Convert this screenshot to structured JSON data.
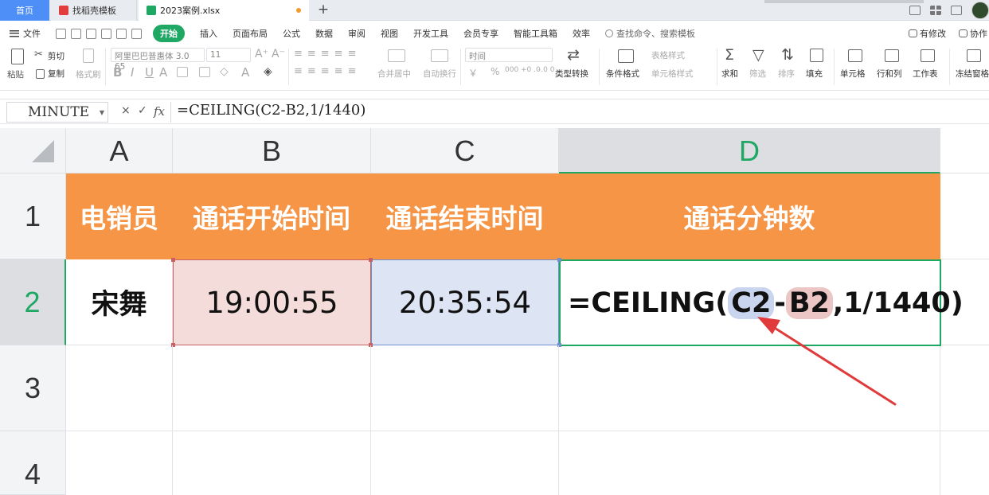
{
  "tabs": {
    "home": "首页",
    "template": "找稻壳模板",
    "file": "2023案例.xlsx",
    "add": "+"
  },
  "menubar": {
    "file": "文件",
    "items": [
      "开始",
      "插入",
      "页面布局",
      "公式",
      "数据",
      "审阅",
      "视图",
      "开发工具",
      "会员专享",
      "智能工具箱",
      "效率"
    ],
    "active_index": 0,
    "search": "查找命令、搜索模板",
    "right": {
      "changes": "有修改",
      "collab": "协作"
    }
  },
  "ribbon": {
    "paste": "粘贴",
    "cut": "剪切",
    "copy": "复制",
    "format_painter": "格式刷",
    "font_name": "阿里巴巴普惠体 3.0 65",
    "font_size": "11",
    "merge": "合并居中",
    "wrap": "自动换行",
    "number_format": "时间",
    "type_convert": "类型转换",
    "cond_format": "条件格式",
    "table_style": "表格样式",
    "cell_style": "单元格样式",
    "sum": "求和",
    "filter": "筛选",
    "sort": "排序",
    "fill": "填充",
    "cell": "单元格",
    "row_col": "行和列",
    "worksheet": "工作表",
    "freeze": "冻结窗格",
    "currency": "￥",
    "percent": "%",
    "thousands": "000",
    "dec_inc": "+0 .0",
    "dec_dec": "-.0 0"
  },
  "formula_bar": {
    "name_box": "MINUTE",
    "cancel": "×",
    "confirm": "✓",
    "fx": "fx",
    "formula": "=CEILING(C2-B2,1/1440)"
  },
  "grid": {
    "columns": [
      "A",
      "B",
      "C",
      "D"
    ],
    "rows": [
      "1",
      "2",
      "3",
      "4"
    ],
    "headers": [
      "电销员",
      "通话开始时间",
      "通话结束时间",
      "通话分钟数"
    ],
    "row2": {
      "a": "宋舞",
      "b": "19:00:55",
      "c": "20:35:54",
      "d_prefix": "=CEILING(",
      "d_ref1": "C2",
      "d_minus": "-",
      "d_ref2": "B2",
      "d_suffix": ",1/1440)"
    }
  },
  "colors": {
    "accent": "#1fa764",
    "header_fill": "#f69546",
    "ref_b2": "#f3dcd9",
    "ref_c2": "#dde4f3",
    "annotation_arrow": "#e03a3a"
  }
}
